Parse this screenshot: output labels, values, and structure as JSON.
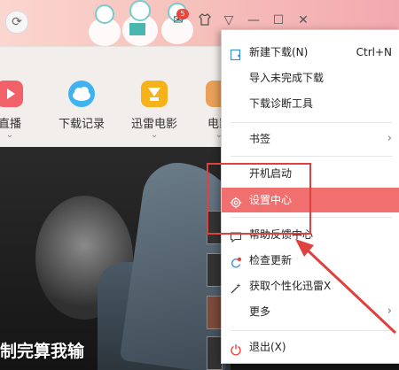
{
  "nav": {
    "items": [
      {
        "label": "直播",
        "caret": "⌄"
      },
      {
        "label": "下载记录",
        "caret": ""
      },
      {
        "label": "迅雷电影",
        "caret": "⌄"
      },
      {
        "label": "电影",
        "caret": "⌄"
      }
    ]
  },
  "titlebar": {
    "message_badge": "5",
    "icons": [
      "refresh-icon",
      "mail-icon",
      "shirt-icon",
      "dropdown-icon",
      "minimize-icon",
      "maximize-icon",
      "close-icon"
    ]
  },
  "content": {
    "caption": "制完算我输"
  },
  "menu": {
    "items": [
      {
        "label": "新建下载(N)",
        "shortcut": "Ctrl+N",
        "icon": "new-download-icon"
      },
      {
        "label": "导入未完成下载",
        "shortcut": "",
        "icon": ""
      },
      {
        "label": "下载诊断工具",
        "shortcut": "",
        "icon": ""
      },
      {
        "label": "书签",
        "shortcut": "",
        "icon": "",
        "submenu": "›"
      },
      {
        "label": "开机启动",
        "shortcut": "",
        "icon": ""
      },
      {
        "label": "设置中心",
        "shortcut": "",
        "icon": "gear-icon",
        "active": true
      },
      {
        "label": "帮助反馈中心",
        "shortcut": "",
        "icon": "feedback-icon"
      },
      {
        "label": "检查更新",
        "shortcut": "",
        "icon": "update-icon"
      },
      {
        "label": "获取个性化迅雷X",
        "shortcut": "",
        "icon": "magic-wand-icon"
      },
      {
        "label": "更多",
        "shortcut": "",
        "icon": "",
        "submenu": "›"
      },
      {
        "label": "退出(X)",
        "shortcut": "",
        "icon": "power-icon"
      }
    ]
  },
  "colors": {
    "menu_highlight": "#f26f6f",
    "annotation_red": "#e0403e"
  }
}
